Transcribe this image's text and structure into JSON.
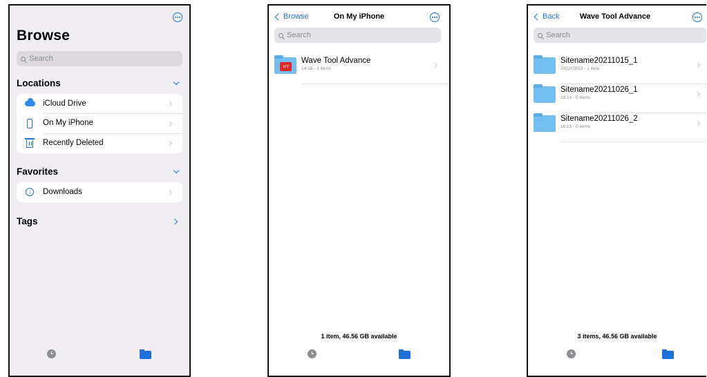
{
  "browse": {
    "title": "Browse",
    "search_placeholder": "Search",
    "locations_header": "Locations",
    "locations": [
      {
        "label": "iCloud Drive",
        "icon": "icloud-icon"
      },
      {
        "label": "On My iPhone",
        "icon": "iphone-icon"
      },
      {
        "label": "Recently Deleted",
        "icon": "trash-icon"
      }
    ],
    "favorites_header": "Favorites",
    "favorites": [
      {
        "label": "Downloads",
        "icon": "download-icon"
      }
    ],
    "tags_header": "Tags"
  },
  "iphone": {
    "back_label": "Browse",
    "title": "On My iPhone",
    "search_placeholder": "Search",
    "items": [
      {
        "name": "Wave  Tool  Advance",
        "meta": "14:18 - 3 items",
        "badge": "WT"
      }
    ],
    "storage": "1 item, 46.56 GB available"
  },
  "wave": {
    "back_label": "Back",
    "title": "Wave  Tool  Advance",
    "search_placeholder": "Search",
    "items": [
      {
        "name": "Sitename20211015_1",
        "meta": "2022/03/23 - 1 item"
      },
      {
        "name": "Sitename20211026_1",
        "meta": "18:13 - 0 items"
      },
      {
        "name": "Sitename20211026_2",
        "meta": "18:13 - 0 items"
      }
    ],
    "storage": "3 items, 46.56 GB available"
  },
  "colors": {
    "accent": "#1e6fd9",
    "folder": "#74bff0",
    "browse_bg": "#f0edf3",
    "badge_red": "#e02a2a"
  }
}
